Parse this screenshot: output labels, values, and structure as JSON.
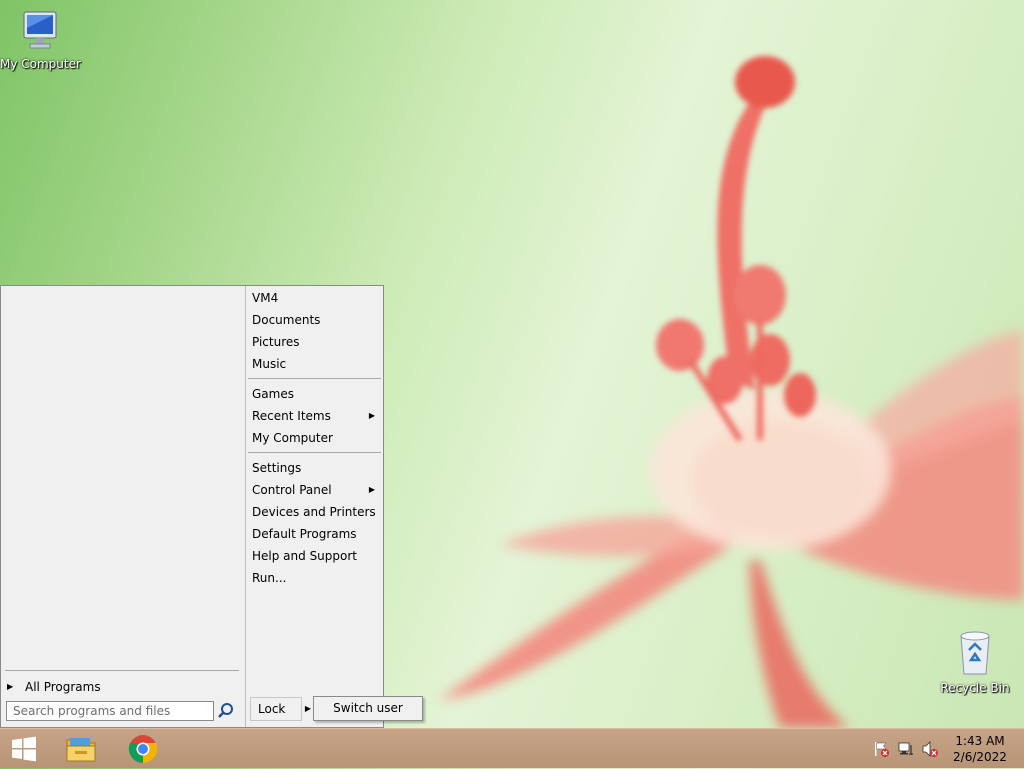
{
  "desktop": {
    "icons": [
      {
        "label": "My Computer",
        "icon": "monitor-icon"
      },
      {
        "label": "Recycle Bin",
        "icon": "recycle-bin-icon"
      }
    ]
  },
  "start_menu": {
    "right_items": [
      {
        "label": "VM4"
      },
      {
        "label": "Documents"
      },
      {
        "label": "Pictures"
      },
      {
        "label": "Music"
      },
      {
        "label": "Games"
      },
      {
        "label": "Recent Items",
        "submenu": true
      },
      {
        "label": "My Computer"
      },
      {
        "label": "Settings"
      },
      {
        "label": "Control Panel",
        "submenu": true
      },
      {
        "label": "Devices and Printers"
      },
      {
        "label": "Default Programs"
      },
      {
        "label": "Help and Support"
      },
      {
        "label": "Run..."
      }
    ],
    "all_programs": "All Programs",
    "search_placeholder": "Search programs and files",
    "lock_label": "Lock",
    "switch_user_label": "Switch user"
  },
  "taskbar": {
    "buttons": [
      {
        "name": "start-button",
        "icon": "windows-logo-icon"
      },
      {
        "name": "file-explorer-button",
        "icon": "folder-icon"
      },
      {
        "name": "chrome-button",
        "icon": "chrome-icon"
      }
    ],
    "tray": [
      "action-center-flag-icon",
      "network-icon",
      "volume-muted-icon"
    ],
    "time": "1:43 AM",
    "date": "2/6/2022"
  },
  "colors": {
    "menu_bg": "#f0f0f0",
    "taskbar": "#c0a084",
    "flower": "#f27a72"
  }
}
